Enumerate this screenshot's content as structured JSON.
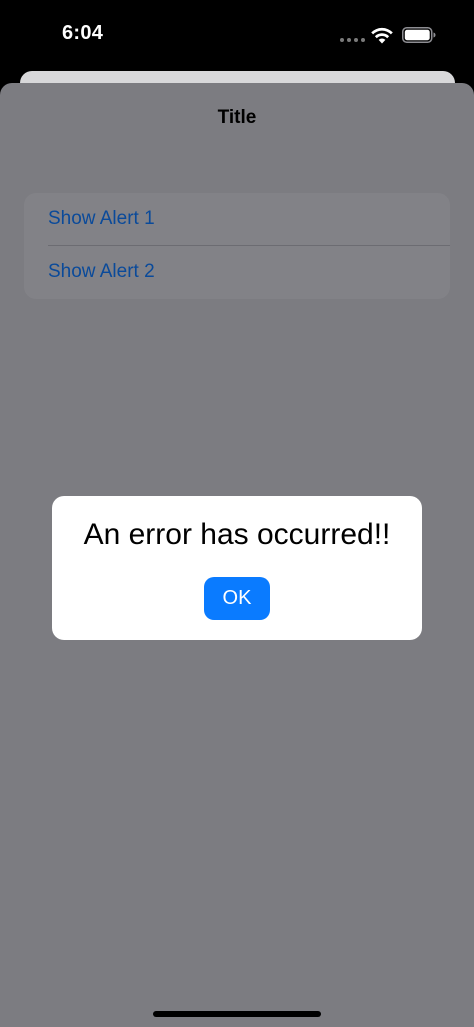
{
  "status_bar": {
    "time": "6:04",
    "wifi_icon": "wifi-icon",
    "battery_icon": "battery-icon"
  },
  "navigation": {
    "title": "Title"
  },
  "list": {
    "items": [
      {
        "label": "Show Alert 1"
      },
      {
        "label": "Show Alert 2"
      }
    ]
  },
  "alert": {
    "message": "An error has occurred!!",
    "ok_label": "OK"
  },
  "colors": {
    "accent": "#0a7bff",
    "link_dimmed": "#0a4a9a",
    "overlay_background": "#7c7c81",
    "alert_background": "#ffffff"
  }
}
